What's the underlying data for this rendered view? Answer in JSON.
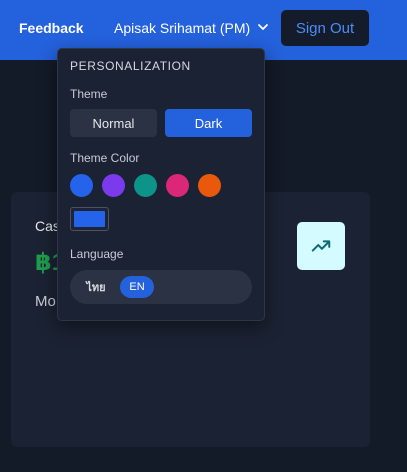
{
  "header": {
    "feedback_label": "Feedback",
    "user_name": "Apisak Srihamat (PM)",
    "signout_label": "Sign Out"
  },
  "card": {
    "title": "Cas",
    "value": "฿1",
    "subtitle": "Mo",
    "trend_icon": "trending-up-icon"
  },
  "personalization": {
    "heading": "PERSONALIZATION",
    "theme_label": "Theme",
    "theme_options": [
      "Normal",
      "Dark"
    ],
    "theme_selected": "Dark",
    "theme_color_label": "Theme Color",
    "theme_colors": [
      "#2563eb",
      "#7c3aed",
      "#0d9488",
      "#db2777",
      "#ea580c"
    ],
    "theme_color_selected": "#2563eb",
    "language_label": "Language",
    "language_options": [
      "ไทย",
      "EN"
    ],
    "language_selected": "EN"
  }
}
